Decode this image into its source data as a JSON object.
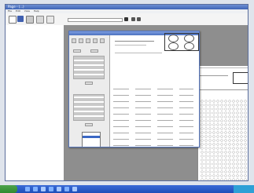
{
  "window": {
    "title": "Page - (...)"
  },
  "menubar": {
    "items": [
      "File",
      "Edit",
      "View",
      "Help"
    ]
  },
  "toolbar": {
    "combo_value": ""
  },
  "sidebar": {
    "header": "",
    "items": [
      "",
      "",
      "",
      "",
      ""
    ]
  },
  "dialog": {
    "title": ""
  },
  "colors": {
    "titlebar": "#3e64b6",
    "taskbar": "#1d4fb8",
    "start": "#2f8a2f",
    "selection": "#3a67c4"
  }
}
